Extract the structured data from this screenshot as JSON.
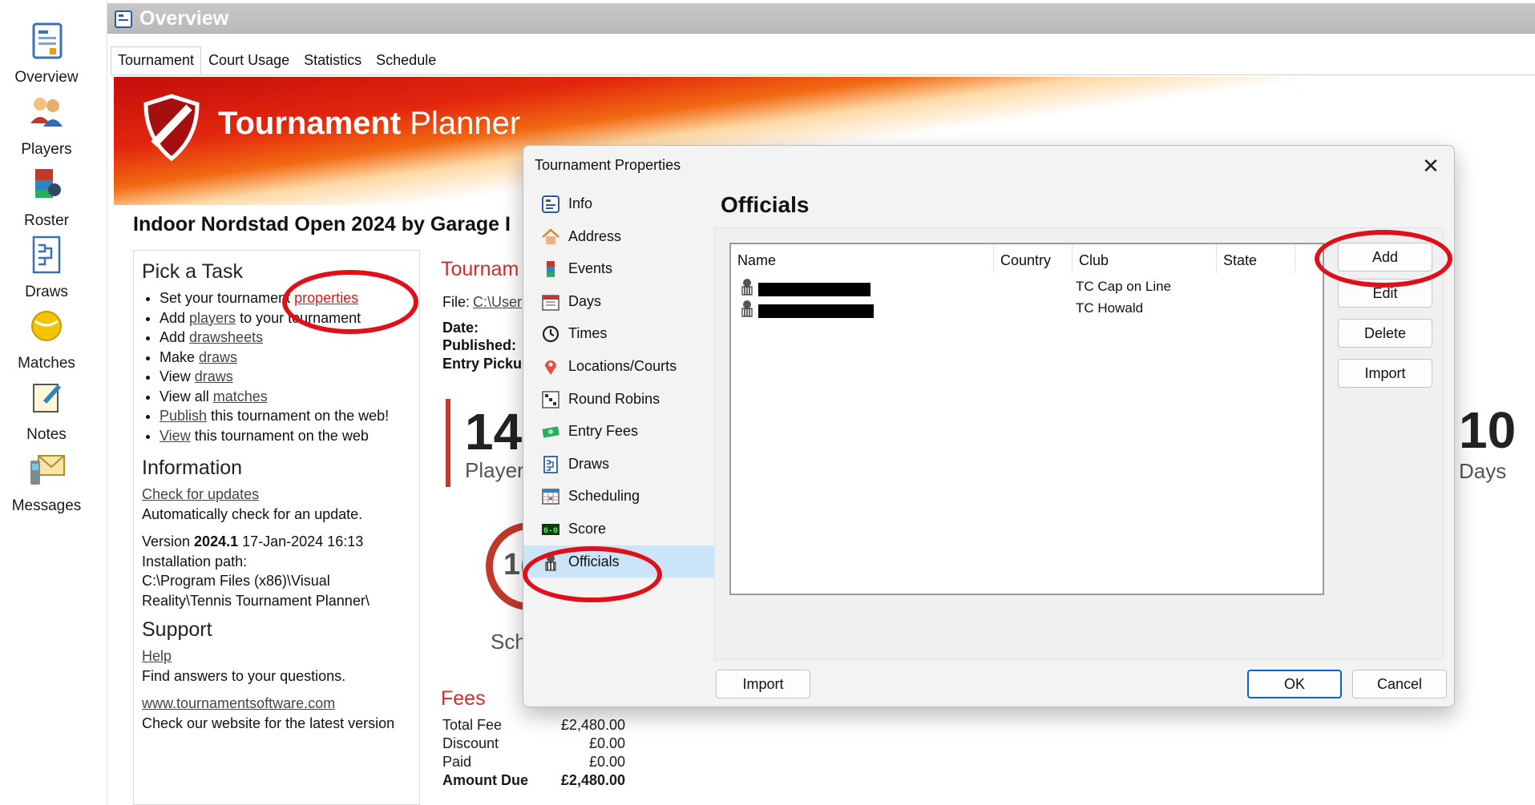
{
  "nav": {
    "items": [
      {
        "label": "Overview",
        "icon": "overview-icon"
      },
      {
        "label": "Players",
        "icon": "players-icon"
      },
      {
        "label": "Roster",
        "icon": "roster-icon"
      },
      {
        "label": "Draws",
        "icon": "draws-icon"
      },
      {
        "label": "Matches",
        "icon": "matches-icon"
      },
      {
        "label": "Notes",
        "icon": "notes-icon"
      },
      {
        "label": "Messages",
        "icon": "messages-icon"
      }
    ]
  },
  "header": {
    "title": "Overview"
  },
  "tabs": [
    {
      "label": "Tournament",
      "active": true
    },
    {
      "label": "Court Usage"
    },
    {
      "label": "Statistics"
    },
    {
      "label": "Schedule"
    }
  ],
  "banner": {
    "brand_bold": "Tournament",
    "brand_light": "Planner"
  },
  "tournament_name": "Indoor Nordstad Open 2024 by Garage I",
  "task": {
    "heading": "Pick a Task",
    "items": [
      {
        "pre": "Set your tournament ",
        "link": "properties",
        "post": ""
      },
      {
        "pre": "Add ",
        "link": "players",
        "post": " to your tournament"
      },
      {
        "pre": "Add ",
        "link": "drawsheets",
        "post": ""
      },
      {
        "pre": "Make ",
        "link": "draws",
        "post": ""
      },
      {
        "pre": "View ",
        "link": "draws",
        "post": ""
      },
      {
        "pre": "View all ",
        "link": "matches",
        "post": ""
      },
      {
        "pre": "",
        "link": "Publish",
        "post": " this tournament on the web!"
      },
      {
        "pre": "",
        "link": "View",
        "post": " this tournament on the web"
      }
    ]
  },
  "information": {
    "heading": "Information",
    "check_link": "Check for updates",
    "check_text": "Automatically check for an update.",
    "version_prefix": "Version ",
    "version": "2024.1",
    "version_date": " 17-Jan-2024 16:13",
    "install_label": "Installation path:",
    "install_path": "C:\\Program Files (x86)\\Visual Reality\\Tennis Tournament Planner\\"
  },
  "support": {
    "heading": "Support",
    "help_link": "Help",
    "help_text": "Find answers to your questions.",
    "web_link": "www.tournamentsoftware.com",
    "web_text": "Check our website for the latest version"
  },
  "summary": {
    "heading": "Tournam",
    "file_label": "File:",
    "file_value": "C:\\User",
    "date_label": "Date:",
    "published_label": "Published:",
    "entry_label": "Entry Picku",
    "players_count": "14",
    "players_caption": "Player",
    "sched_partial_num": "1(",
    "sched_caption": "Sch",
    "days_count": "10",
    "days_caption": "Days"
  },
  "fees": {
    "heading": "Fees",
    "rows": [
      {
        "label": "Total Fee",
        "value": "£2,480.00"
      },
      {
        "label": "Discount",
        "value": "£0.00"
      },
      {
        "label": "Paid",
        "value": "£0.00"
      },
      {
        "label": "Amount Due",
        "value": "£2,480.00"
      }
    ]
  },
  "dialog": {
    "title": "Tournament Properties",
    "close": "✕",
    "heading": "Officials",
    "nav": [
      {
        "label": "Info",
        "icon": "info-icon"
      },
      {
        "label": "Address",
        "icon": "home-icon"
      },
      {
        "label": "Events",
        "icon": "events-icon"
      },
      {
        "label": "Days",
        "icon": "calendar-icon"
      },
      {
        "label": "Times",
        "icon": "clock-icon"
      },
      {
        "label": "Locations/Courts",
        "icon": "location-pin-icon"
      },
      {
        "label": "Round Robins",
        "icon": "round-robin-icon"
      },
      {
        "label": "Entry Fees",
        "icon": "money-icon"
      },
      {
        "label": "Draws",
        "icon": "draws-icon"
      },
      {
        "label": "Scheduling",
        "icon": "scheduling-icon"
      },
      {
        "label": "Score",
        "icon": "score-icon"
      },
      {
        "label": "Officials",
        "icon": "official-icon",
        "selected": true
      }
    ],
    "columns": [
      "Name",
      "Country",
      "Club",
      "State"
    ],
    "rows": [
      {
        "club": "TC Cap on Line"
      },
      {
        "club": "TC Howald"
      }
    ],
    "side_buttons": [
      "Add",
      "Edit",
      "Delete",
      "Import"
    ],
    "import_label": "Import",
    "ok_label": "OK",
    "cancel_label": "Cancel"
  },
  "colors": {
    "accent_red": "#d81a1a",
    "annotation_red": "#e0101a",
    "selection_blue": "#cce4f7",
    "primary_border": "#0a64c8"
  }
}
